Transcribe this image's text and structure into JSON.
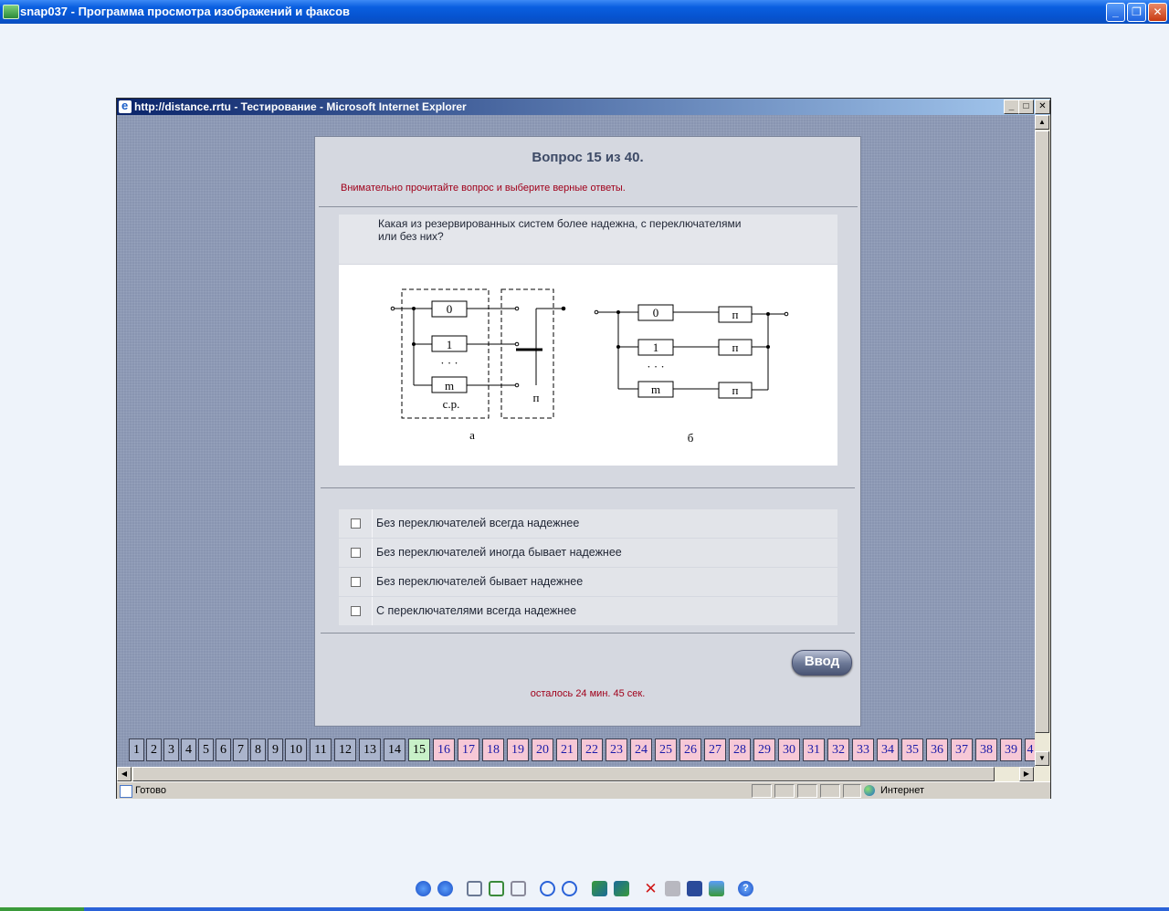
{
  "outer_window": {
    "title": "snap037 - Программа просмотра изображений и факсов"
  },
  "browser": {
    "title": "http://distance.rrtu - Тестирование - Microsoft Internet Explorer",
    "status": "Готово",
    "zone": "Интернет"
  },
  "test": {
    "header": "Вопрос 15 из 40.",
    "instruction": "Внимательно прочитайте вопрос и выберите верные ответы.",
    "question": "Какая из резервированных систем более надежна, с переключателями или без них?",
    "diagram": {
      "left_labels": [
        "0",
        "1",
        "m"
      ],
      "left_dots": "· · ·",
      "left_caption_sr": "с.р.",
      "switch_label": "п",
      "left_caption": "а",
      "right_labels": [
        "0",
        "1",
        "m"
      ],
      "right_switch_labels": [
        "п",
        "п",
        "п"
      ],
      "right_dots": "· · ·",
      "right_caption": "б"
    },
    "answers": [
      "Без переключателей всегда надежнее",
      "Без переключателей иногда бывает надежнее",
      "Без переключателей бывает надежнее",
      "С переключателями всегда надежнее"
    ],
    "submit_label": "Ввод",
    "timer": "осталось 24 мин. 45 сек."
  },
  "pager": {
    "current": 15,
    "numbers": [
      "1",
      "2",
      "3",
      "4",
      "5",
      "6",
      "7",
      "8",
      "9",
      "10",
      "11",
      "12",
      "13",
      "14",
      "15",
      "16",
      "17",
      "18",
      "19",
      "20",
      "21",
      "22",
      "23",
      "24",
      "25",
      "26",
      "27",
      "28",
      "29",
      "30",
      "31",
      "32",
      "33",
      "34",
      "35",
      "36",
      "37",
      "38",
      "39",
      "4"
    ]
  },
  "colors": {
    "done": "#aab4cc",
    "current": "#c8f0c8",
    "todo": "#f6c8d6",
    "alert_text": "#a0001a"
  }
}
